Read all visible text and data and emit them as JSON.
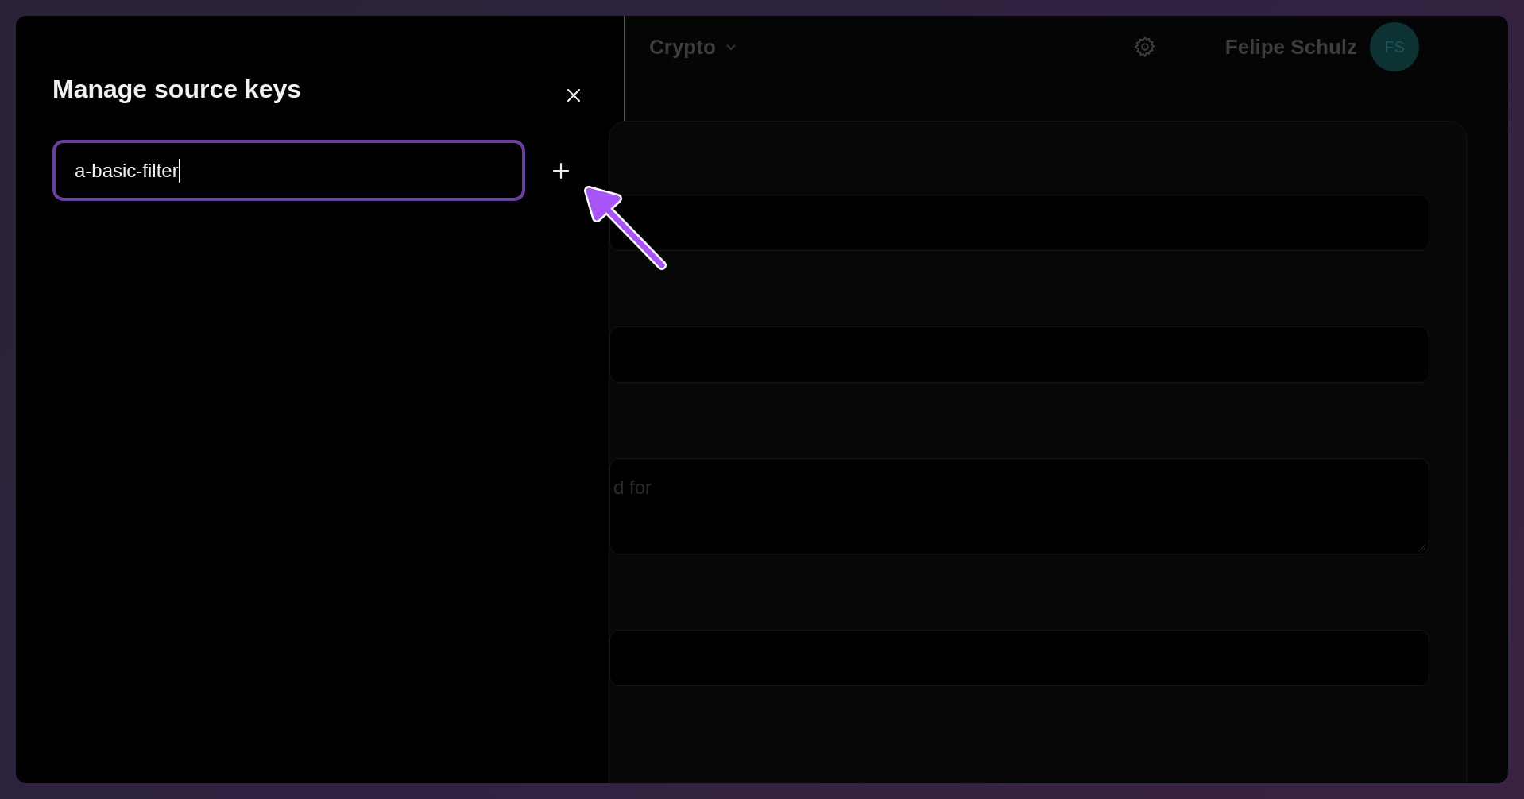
{
  "panel": {
    "title": "Manage source keys",
    "input": {
      "value": "a-basic-filter",
      "focused": true
    }
  },
  "background": {
    "header": {
      "workspace": "Crypto",
      "user_name": "Felipe Schulz",
      "avatar_initials": "FS"
    },
    "form": {
      "fields": [
        {
          "kind": "input"
        },
        {
          "kind": "input"
        },
        {
          "kind": "textarea",
          "placeholder": "d for"
        },
        {
          "kind": "input"
        }
      ]
    }
  }
}
